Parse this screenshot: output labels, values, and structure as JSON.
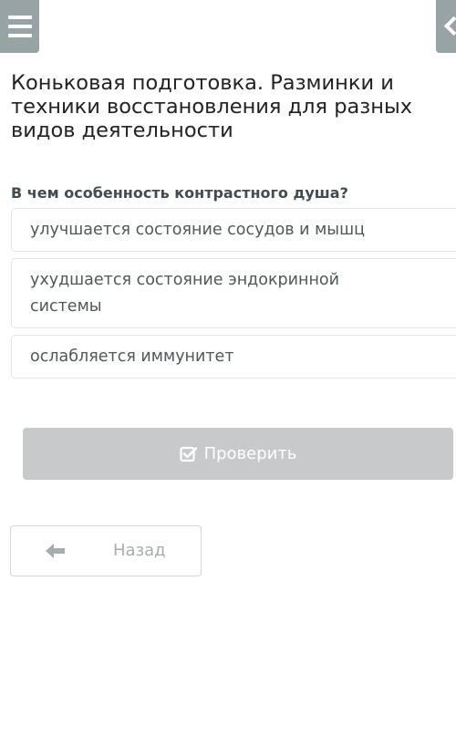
{
  "header": {
    "menu_icon": "hamburger-menu-icon",
    "right_icon": "chevron-left-icon",
    "lesson_title": "Коньковая подготовка. Разминки и техники восстановления для разных видов деятельности"
  },
  "quiz": {
    "question": "В чем особенность контрастного душа?",
    "options": [
      {
        "label": "улучшается состояние сосудов и мышц"
      },
      {
        "label": "ухудшается состояние эндокринной системы"
      },
      {
        "label": "ослабляется иммунитет"
      }
    ],
    "check_button": {
      "label": "Проверить",
      "icon": "check-square-icon"
    }
  },
  "navigation": {
    "back_button": {
      "label": "Назад",
      "icon": "arrow-left-icon"
    }
  },
  "colors": {
    "header_buttons": "#98a3a6",
    "check_button_disabled": "#c8c9cb",
    "text_primary": "#222222",
    "question_text": "#444b50",
    "option_text": "#50565a",
    "option_border": "#e3e5e7",
    "back_text": "#a9acaf"
  }
}
